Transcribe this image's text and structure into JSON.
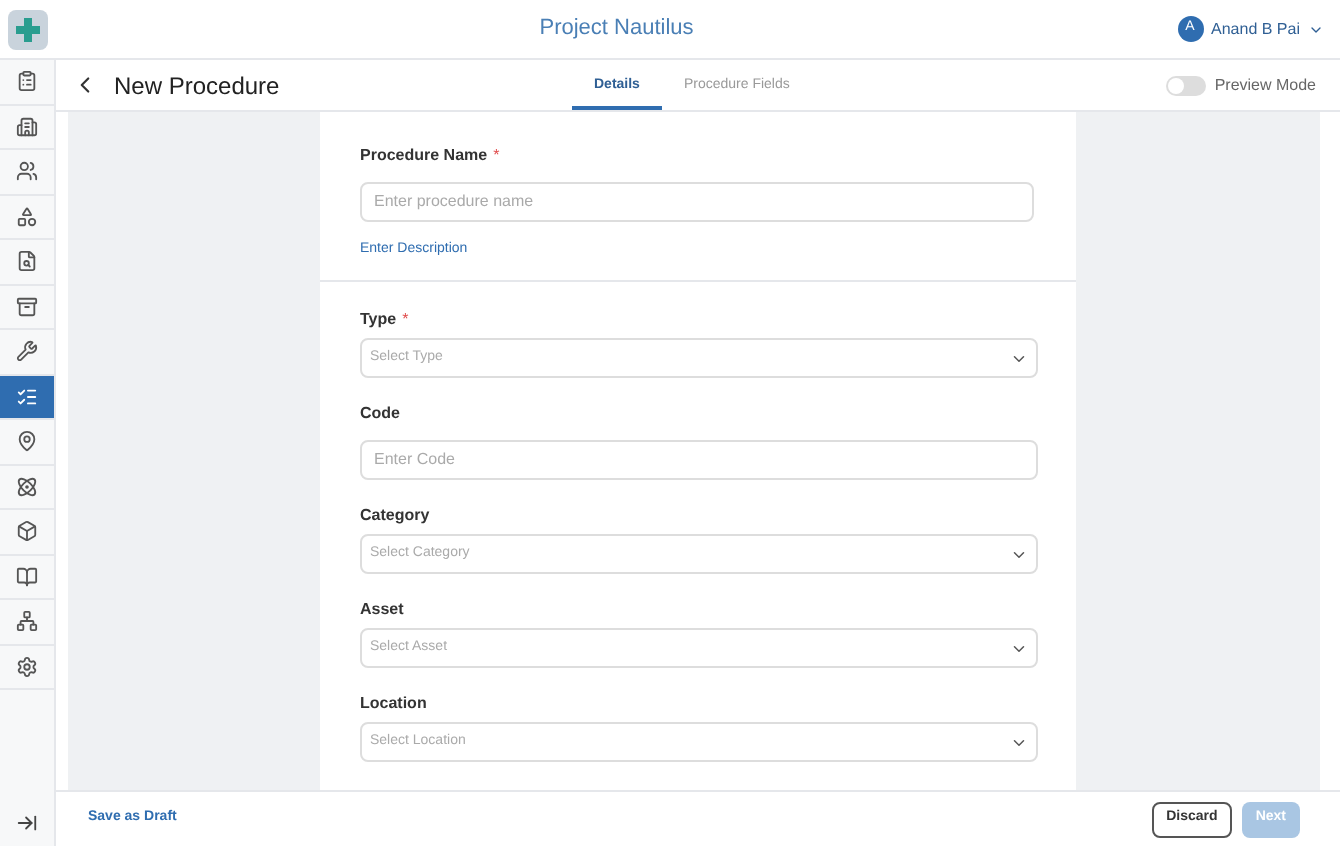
{
  "app_title": "Project Nautilus",
  "user": {
    "initial": "A",
    "name": "Anand B Pai"
  },
  "sidebar": {
    "items": [
      {
        "selected": false
      },
      {
        "selected": false
      },
      {
        "selected": false
      },
      {
        "selected": false
      },
      {
        "selected": false
      },
      {
        "selected": false
      },
      {
        "selected": false
      },
      {
        "selected": true
      },
      {
        "selected": false
      },
      {
        "selected": false
      },
      {
        "selected": false
      },
      {
        "selected": false
      },
      {
        "selected": false
      },
      {
        "selected": false
      }
    ]
  },
  "page_title": "New Procedure",
  "tabs": [
    {
      "label": "Details",
      "selected": true
    },
    {
      "label": "Procedure Fields",
      "selected": false
    }
  ],
  "preview_mode": {
    "label": "Preview Mode",
    "on": false
  },
  "name_field": {
    "label": "Procedure Name",
    "required_mark": "*",
    "placeholder": "Enter procedure name"
  },
  "description_link": "Enter Description",
  "fields": [
    {
      "kind": "select",
      "label": "Type",
      "required_mark": "*",
      "placeholder": "Select Type"
    },
    {
      "kind": "text",
      "label": "Code",
      "placeholder": "Enter Code"
    },
    {
      "kind": "select",
      "label": "Category",
      "placeholder": "Select Category"
    },
    {
      "kind": "select",
      "label": "Asset",
      "placeholder": "Select Asset"
    },
    {
      "kind": "select",
      "label": "Location",
      "placeholder": "Select Location"
    }
  ],
  "footer": {
    "draft": "Save as Draft",
    "discard": "Discard",
    "next": {
      "label": "Next",
      "disabled": true
    }
  }
}
